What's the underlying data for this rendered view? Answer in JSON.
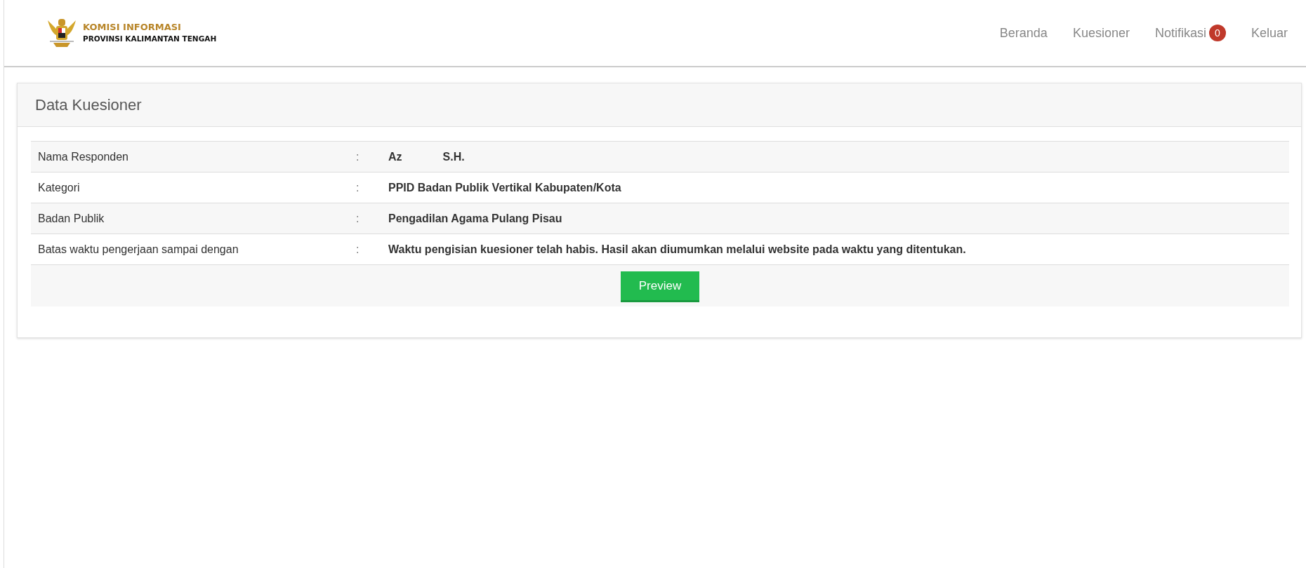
{
  "brand": {
    "line_1": "KOMISI INFORMASI",
    "line_2": "PROVINSI KALIMANTAN TENGAH"
  },
  "nav": [
    {
      "label": "Beranda"
    },
    {
      "label": "Kuesioner"
    },
    {
      "label": "Notifikasi",
      "badge": "0"
    },
    {
      "label": "Keluar"
    }
  ],
  "card": {
    "title": "Data Kuesioner",
    "rows": [
      {
        "label": "Nama Responden",
        "separator": ":",
        "value_parts": [
          "Az",
          "S.H."
        ]
      },
      {
        "label": "Kategori",
        "separator": ":",
        "value_parts": [
          "PPID Badan Publik Vertikal Kabupaten/Kota"
        ]
      },
      {
        "label": "Badan Publik",
        "separator": ":",
        "value_parts": [
          "Pengadilan Agama Pulang Pisau"
        ]
      },
      {
        "label": "Batas waktu pengerjaan sampai dengan",
        "separator": ":",
        "value_parts": [
          "Waktu pengisian kuesioner telah habis. Hasil akan diumumkan melalui website pada waktu yang ditentukan."
        ]
      }
    ],
    "button": "Preview"
  }
}
